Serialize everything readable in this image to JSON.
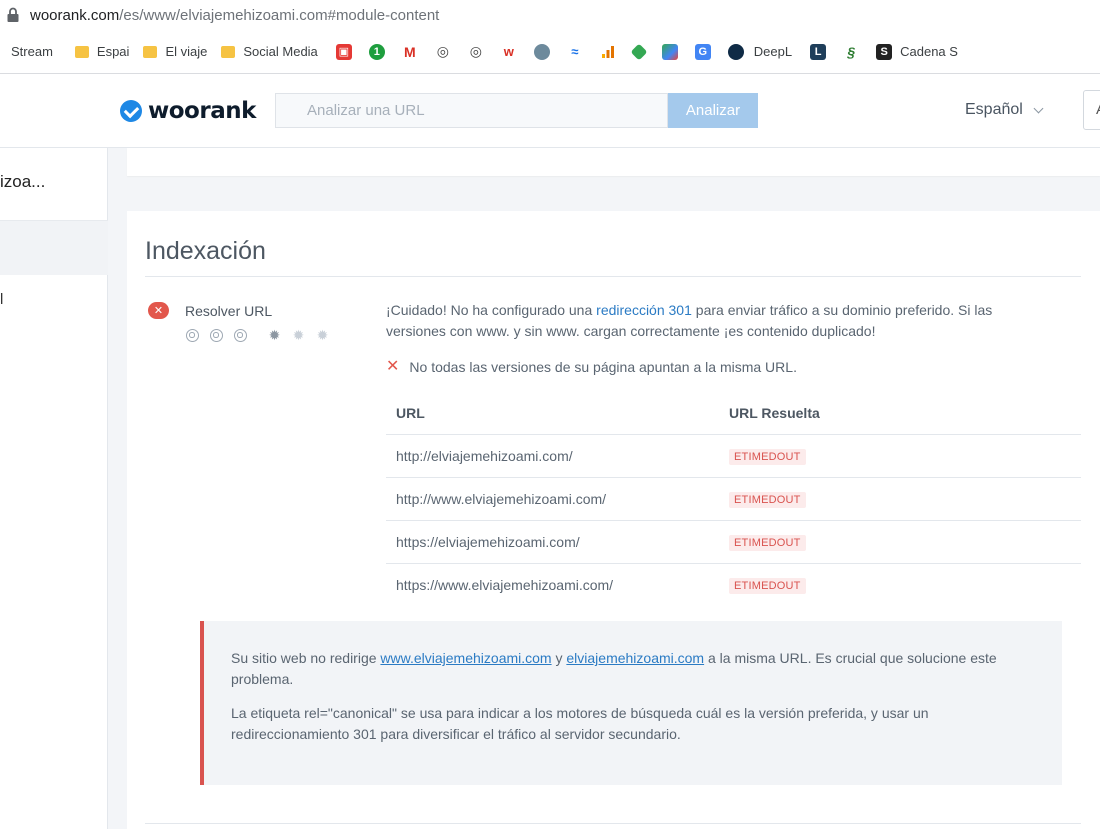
{
  "browser": {
    "url_host": "woorank.com",
    "url_rest": "/es/www/elviajemehizoami.com#module-content"
  },
  "bookmarks": {
    "stream": "Stream",
    "espai": "Espai",
    "el_viaje": "El viaje",
    "social_media": "Social Media",
    "deepl": "DeepL",
    "cadena": "Cadena S"
  },
  "header": {
    "logo_text": "woorank",
    "search_placeholder": "Analizar una URL",
    "analyze_label": "Analizar",
    "language": "Español",
    "login_initial": "A"
  },
  "sidebar": {
    "site_name": "izoa...",
    "item_label": "l"
  },
  "section": {
    "title": "Indexación",
    "check_name": "Resolver URL",
    "desc_prefix": "¡Cuidado! No ha configurado una ",
    "desc_link": "redirección 301",
    "desc_suffix": " para enviar tráfico a su dominio preferido. Si las versiones con www. y sin www. cargan correctamente ¡es contenido duplicado!",
    "fail_text": "No todas las versiones de su página apuntan a la misma URL.",
    "table": {
      "headers": [
        "URL",
        "URL Resuelta"
      ],
      "rows": [
        {
          "url": "http://elviajemehizoami.com/",
          "result": "ETIMEDOUT"
        },
        {
          "url": "http://www.elviajemehizoami.com/",
          "result": "ETIMEDOUT"
        },
        {
          "url": "https://elviajemehizoami.com/",
          "result": "ETIMEDOUT"
        },
        {
          "url": "https://www.elviajemehizoami.com/",
          "result": "ETIMEDOUT"
        }
      ]
    },
    "notice": {
      "p1_a": "Su sitio web no redirige ",
      "p1_link1": "www.elviajemehizoami.com",
      "p1_b": " y ",
      "p1_link2": "elviajemehizoami.com",
      "p1_c": " a la misma URL. Es crucial que solucione este problema.",
      "p2": "La etiqueta rel=\"canonical\" se usa para indicar a los motores de búsqueda cuál es la versión preferida, y usar un redireccionamiento 301 para diversificar el tráfico al servidor secundario."
    }
  },
  "colors": {
    "brand_blue": "#1e88e5",
    "error_red": "#e2574c",
    "link_blue": "#2b7bc4",
    "button_disabled": "#a4c9ec"
  },
  "icons": [
    "lock-icon",
    "folder-icon",
    "woorank-check-icon",
    "error-x-icon",
    "difficulty-target-icon",
    "gear-icon",
    "chevron-down-icon"
  ]
}
